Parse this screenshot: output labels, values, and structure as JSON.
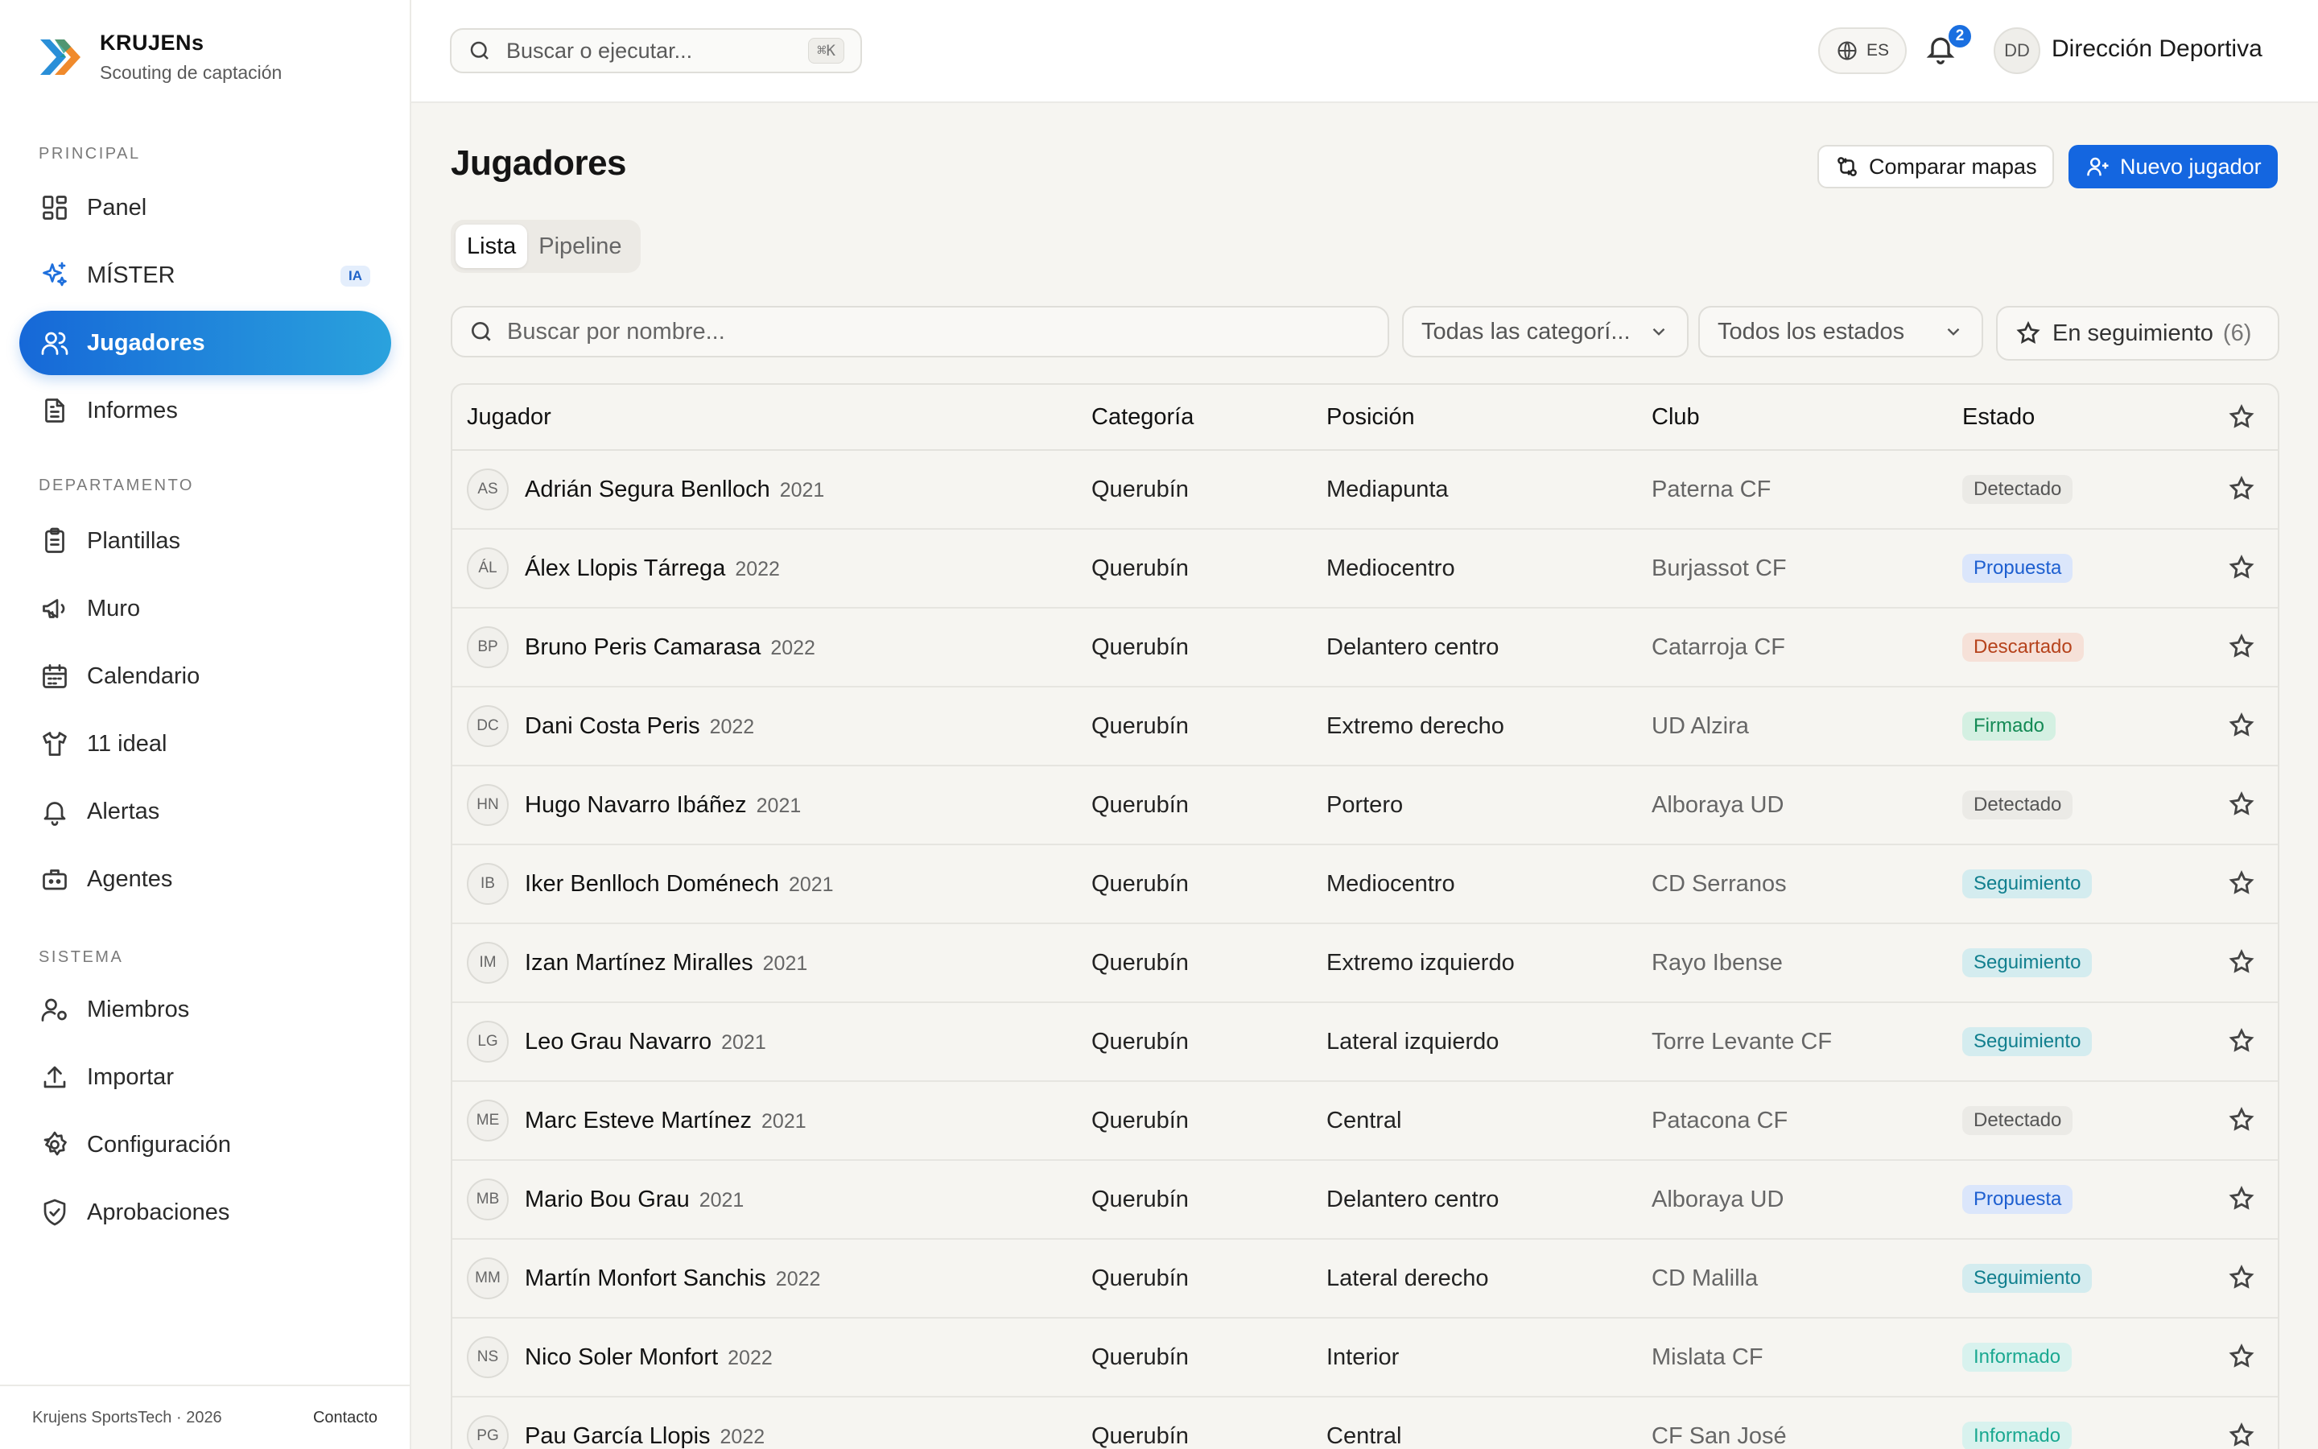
{
  "brand": {
    "name": "KRUJENs",
    "subtitle": "Scouting de captación"
  },
  "sidebar": {
    "sections": [
      {
        "label": "PRINCIPAL"
      },
      {
        "label": "DEPARTAMENTO"
      },
      {
        "label": "SISTEMA"
      }
    ],
    "items": [
      {
        "label": "Panel",
        "icon": "dashboard-icon"
      },
      {
        "label": "MÍSTER",
        "icon": "sparkles-icon",
        "badge": "IA"
      },
      {
        "label": "Jugadores",
        "icon": "users-icon",
        "active": true
      },
      {
        "label": "Informes",
        "icon": "document-icon"
      },
      {
        "label": "Plantillas",
        "icon": "clipboard-icon"
      },
      {
        "label": "Muro",
        "icon": "megaphone-icon"
      },
      {
        "label": "Calendario",
        "icon": "calendar-icon"
      },
      {
        "label": "11 ideal",
        "icon": "shirt-icon"
      },
      {
        "label": "Alertas",
        "icon": "bell-icon"
      },
      {
        "label": "Agentes",
        "icon": "briefcase-icon"
      },
      {
        "label": "Miembros",
        "icon": "user-cog-icon"
      },
      {
        "label": "Importar",
        "icon": "upload-icon"
      },
      {
        "label": "Configuración",
        "icon": "gear-icon"
      },
      {
        "label": "Aprobaciones",
        "icon": "shield-check-icon"
      }
    ],
    "footer": {
      "copyright": "Krujens SportsTech · 2026",
      "contact": "Contacto"
    }
  },
  "topbar": {
    "search_placeholder": "Buscar o ejecutar...",
    "shortcut": "⌘K",
    "language": "ES",
    "notifications": "2",
    "user_initials": "DD",
    "user_name": "Dirección Deportiva"
  },
  "page": {
    "title": "Jugadores",
    "compare_label": "Comparar mapas",
    "new_label": "Nuevo jugador",
    "tabs": [
      {
        "label": "Lista",
        "active": true
      },
      {
        "label": "Pipeline"
      }
    ],
    "search_placeholder": "Buscar por nombre...",
    "filter_category": "Todas las categorí...",
    "filter_status": "Todos los estados",
    "follow_label": "En seguimiento",
    "follow_count": "(6)"
  },
  "colors": {
    "accent": "#1466e0",
    "active_gradient_start": "#1668d8",
    "active_gradient_end": "#2aa2dd"
  },
  "table": {
    "headers": {
      "player": "Jugador",
      "category": "Categoría",
      "position": "Posición",
      "club": "Club",
      "status": "Estado"
    },
    "rows": [
      {
        "initials": "AS",
        "name": "Adrián Segura Benlloch",
        "year": "2021",
        "category": "Querubín",
        "position": "Mediapunta",
        "club": "Paterna CF",
        "status": "Detectado",
        "status_class": "st-detectado"
      },
      {
        "initials": "ÁL",
        "name": "Álex Llopis Tárrega",
        "year": "2022",
        "category": "Querubín",
        "position": "Mediocentro",
        "club": "Burjassot CF",
        "status": "Propuesta",
        "status_class": "st-propuesta"
      },
      {
        "initials": "BP",
        "name": "Bruno Peris Camarasa",
        "year": "2022",
        "category": "Querubín",
        "position": "Delantero centro",
        "club": "Catarroja CF",
        "status": "Descartado",
        "status_class": "st-descartado"
      },
      {
        "initials": "DC",
        "name": "Dani Costa Peris",
        "year": "2022",
        "category": "Querubín",
        "position": "Extremo derecho",
        "club": "UD Alzira",
        "status": "Firmado",
        "status_class": "st-firmado"
      },
      {
        "initials": "HN",
        "name": "Hugo Navarro Ibáñez",
        "year": "2021",
        "category": "Querubín",
        "position": "Portero",
        "club": "Alboraya UD",
        "status": "Detectado",
        "status_class": "st-detectado"
      },
      {
        "initials": "IB",
        "name": "Iker Benlloch Doménech",
        "year": "2021",
        "category": "Querubín",
        "position": "Mediocentro",
        "club": "CD Serranos",
        "status": "Seguimiento",
        "status_class": "st-seguimiento"
      },
      {
        "initials": "IM",
        "name": "Izan Martínez Miralles",
        "year": "2021",
        "category": "Querubín",
        "position": "Extremo izquierdo",
        "club": "Rayo Ibense",
        "status": "Seguimiento",
        "status_class": "st-seguimiento"
      },
      {
        "initials": "LG",
        "name": "Leo Grau Navarro",
        "year": "2021",
        "category": "Querubín",
        "position": "Lateral izquierdo",
        "club": "Torre Levante CF",
        "status": "Seguimiento",
        "status_class": "st-seguimiento"
      },
      {
        "initials": "ME",
        "name": "Marc Esteve Martínez",
        "year": "2021",
        "category": "Querubín",
        "position": "Central",
        "club": "Patacona CF",
        "status": "Detectado",
        "status_class": "st-detectado"
      },
      {
        "initials": "MB",
        "name": "Mario Bou Grau",
        "year": "2021",
        "category": "Querubín",
        "position": "Delantero centro",
        "club": "Alboraya UD",
        "status": "Propuesta",
        "status_class": "st-propuesta"
      },
      {
        "initials": "MM",
        "name": "Martín Monfort Sanchis",
        "year": "2022",
        "category": "Querubín",
        "position": "Lateral derecho",
        "club": "CD Malilla",
        "status": "Seguimiento",
        "status_class": "st-seguimiento"
      },
      {
        "initials": "NS",
        "name": "Nico Soler Monfort",
        "year": "2022",
        "category": "Querubín",
        "position": "Interior",
        "club": "Mislata CF",
        "status": "Informado",
        "status_class": "st-informado"
      },
      {
        "initials": "PG",
        "name": "Pau García Llopis",
        "year": "2022",
        "category": "Querubín",
        "position": "Central",
        "club": "CF San José",
        "status": "Informado",
        "status_class": "st-informado"
      }
    ]
  }
}
